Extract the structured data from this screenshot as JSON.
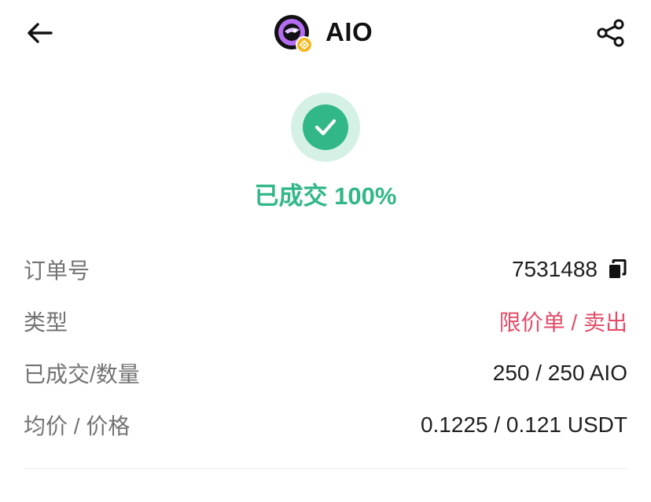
{
  "header": {
    "title": "AIO"
  },
  "status": {
    "text": "已成交 100%",
    "color": "#31b788"
  },
  "order": {
    "rows": [
      {
        "label": "订单号",
        "value": "7531488"
      },
      {
        "label": "类型",
        "value": "限价单 / 卖出"
      },
      {
        "label": "已成交/数量",
        "value": "250 / 250 AIO"
      },
      {
        "label": "均价 / 价格",
        "value": "0.1225 / 0.121 USDT"
      }
    ]
  },
  "colors": {
    "success": "#31b788",
    "sell": "#e24c68",
    "label": "#737373"
  },
  "icons": {
    "back": "arrow-left-icon",
    "share": "share-icon",
    "copy": "copy-icon",
    "check": "check-icon",
    "coin": "aio-coin-logo",
    "badge": "bnb-chain-badge-icon"
  }
}
